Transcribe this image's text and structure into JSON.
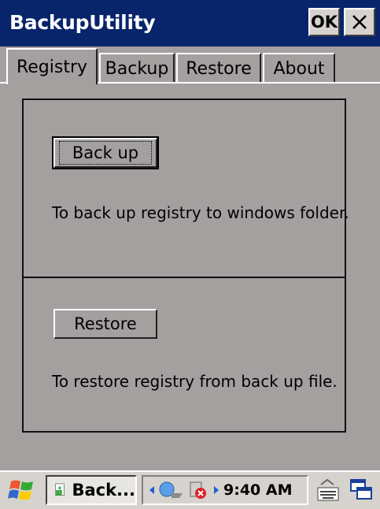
{
  "window": {
    "title": "BackupUtility",
    "ok_label": "OK",
    "close_label": "×"
  },
  "tabs": [
    {
      "label": "Registry",
      "active": true
    },
    {
      "label": "Backup",
      "active": false
    },
    {
      "label": "Restore",
      "active": false
    },
    {
      "label": "About",
      "active": false
    }
  ],
  "registry": {
    "backup_button": "Back up",
    "backup_desc": "To back up registry to windows folder.",
    "restore_button": "Restore",
    "restore_desc": "To restore registry from back up file."
  },
  "taskbar": {
    "task_label": "Back...",
    "time": "9:40 AM",
    "icons": [
      "windows-start-icon",
      "backup-app-icon",
      "network-icon",
      "security-alert-icon",
      "keyboard-icon",
      "switch-window-icon"
    ]
  },
  "colors": {
    "title_bar": "#08246b",
    "window_bg": "#a4a0a0",
    "taskbar_bg": "#d6d3ce"
  }
}
